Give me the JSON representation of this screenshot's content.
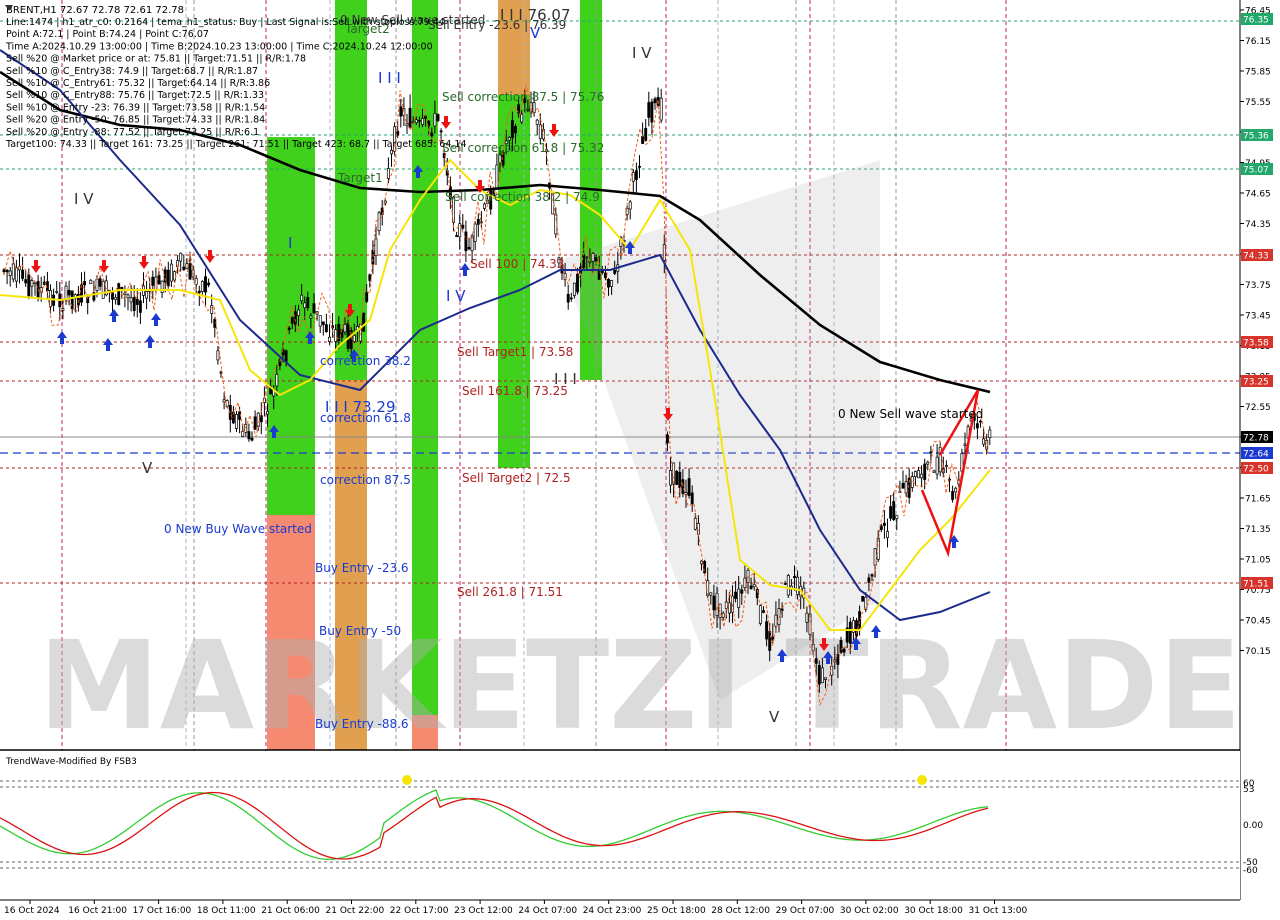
{
  "symbol_header": "BRENT,H1  72.67 72.78 72.61 72.78",
  "info_lines": [
    "Line:1474  |  h1_atr_c0: 0.2164  |  tema_h1_status: Buy  |  Last Signal is:Sell with stoploss:79.44",
    "Point A:72.1  |  Point B:74.24  |  Point C:76.07",
    "Time A:2024.10.29 13:00:00  |  Time B:2024.10.23 13:00:00  |  Time C:2024.10.24 12:00:00",
    "Sell %20 @ Market price or at: 75.81  ||  Target:71.51  ||  R/R:1.78",
    "Sell %10 @ C_Entry38: 74.9  ||  Target:68.7  ||  R/R:1.87",
    "Sell %10 @ C_Entry61: 75.32  ||  Target:64.14  ||  R/R:3.86",
    "Sell %10 @ C_Entry88: 75.76  ||  Target:72.5  ||  R/R:1.33",
    "Sell %10 @ Entry -23: 76.39  ||  Target:73.58  ||  R/R:1.54",
    "Sell %20 @ Entry -50: 76.85  ||  Target:74.33  ||  R/R:1.84",
    "Sell %20 @ Entry -88: 77.52  ||  Target:73.25  ||  R/R:6.1",
    "Target100: 74.33  ||  Target 161: 73.25  ||  Target 261: 71.51  ||  Target 423: 68.7  ||  Target 685: 64.14"
  ],
  "price_axis": {
    "labels": [
      "76.45",
      "76.15",
      "75.85",
      "75.55",
      "75.25",
      "74.95",
      "74.65",
      "74.35",
      "74.05",
      "73.75",
      "73.45",
      "73.15",
      "72.85",
      "72.55",
      "72.25",
      "71.95",
      "71.65",
      "71.35",
      "71.05",
      "70.75",
      "70.45",
      "70.15"
    ],
    "badges": [
      {
        "text": "76.35",
        "color": "#22a86b"
      },
      {
        "text": "75.36",
        "color": "#22a86b"
      },
      {
        "text": "75.07",
        "color": "#22a86b"
      },
      {
        "text": "74.33",
        "color": "#d8332a"
      },
      {
        "text": "73.58",
        "color": "#d8332a"
      },
      {
        "text": "73.25",
        "color": "#d8332a"
      },
      {
        "text": "72.78",
        "color": "#000000"
      },
      {
        "text": "72.64",
        "color": "#1a3ad0"
      },
      {
        "text": "72.50",
        "color": "#d8332a"
      },
      {
        "text": "71.51",
        "color": "#d8332a"
      }
    ]
  },
  "time_axis": [
    "16 Oct 2024",
    "16 Oct 21:00",
    "17 Oct 16:00",
    "18 Oct 11:00",
    "21 Oct 06:00",
    "21 Oct 22:00",
    "22 Oct 17:00",
    "23 Oct 12:00",
    "24 Oct 07:00",
    "24 Oct 23:00",
    "25 Oct 18:00",
    "28 Oct 12:00",
    "29 Oct 07:00",
    "30 Oct 02:00",
    "30 Oct 18:00",
    "31 Oct 13:00"
  ],
  "chart_labels": {
    "c_top": "I I I 76.07",
    "sell_entry_top": "Sell Entry -23.6 | 76.39",
    "sell_corr_87": "Sell correction 87.5 | 75.76",
    "sell_corr_61": "Sell correction 61.8 | 75.32",
    "sell_corr_38": "Sell correction 38.2 | 74.9",
    "sell_100": "Sell 100 | 74.33",
    "sell_target1": "Sell Target1 | 73.58",
    "sell_161": "Sell 161.8 | 73.25",
    "sell_target2": "Sell Target2 | 72.5",
    "sell_261": "Sell  261.8 | 71.51",
    "correction_38": "correction 38.2",
    "correction_61": "correction 61.8",
    "correction_87": "correction 87.5",
    "iii_7329": "I I I 73.29",
    "buy_entry_23": "Buy Entry -23.6",
    "buy_entry_50": "Buy Entry -50",
    "buy_entry_88": "Buy Entry -88.6",
    "new_buy_wave": "0 New Buy Wave started",
    "new_sell_wave": "0 New Sell wave started",
    "new_sell_wave_top": "0 New Sell wave started",
    "target1": "Target1",
    "target2": "Target2",
    "wave_iv_left": "I V",
    "wave_v_left": "V",
    "wave_i": "I",
    "wave_iii": "I I I",
    "wave_iv_mid": "I V",
    "wave_iv_top": "I V",
    "wave_iii_low": "I I I",
    "wave_v_bottom": "V",
    "wave_v_top": "V"
  },
  "watermark": "MARKETZI TRADE",
  "indicator": {
    "title": "TrendWave-Modified By FSB3",
    "levels": [
      "60",
      "53",
      "0.00",
      "-50",
      "-60"
    ]
  },
  "colors": {
    "bull_candle": "#000000",
    "ema_black": "#000000",
    "ma_blue": "#1c2a8c",
    "ma_yellow": "#f5e60a",
    "zone_green": "#3fd11b",
    "zone_orange": "#e0a050",
    "zone_salmon": "#f58a70",
    "wave_red": "#ee1111",
    "osc_green": "#33cc33",
    "osc_red": "#dd1111"
  }
}
